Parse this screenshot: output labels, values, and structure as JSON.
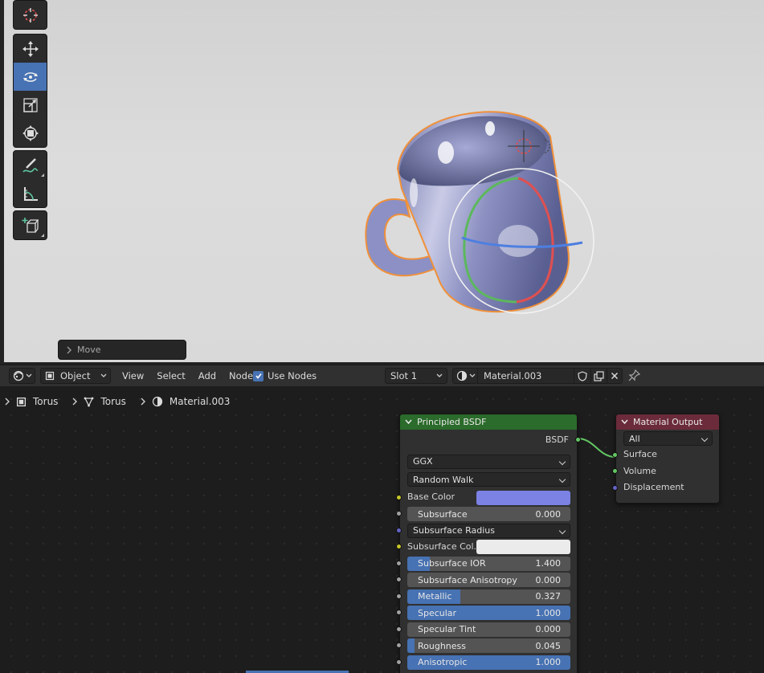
{
  "viewport": {
    "last_operator": "Move"
  },
  "node_editor": {
    "header": {
      "object_mode": "Object",
      "menus": [
        "View",
        "Select",
        "Add",
        "Node"
      ],
      "use_nodes_label": "Use Nodes",
      "use_nodes_checked": true,
      "slot": "Slot 1",
      "material_name": "Material.003"
    },
    "breadcrumb": [
      "Torus",
      "Torus",
      "Material.003"
    ],
    "principled_node": {
      "title": "Principled BSDF",
      "header_color": "#2b6b2b",
      "output_label": "BSDF",
      "distribution": "GGX",
      "subsurface_method": "Random Walk",
      "base_color_label": "Base Color",
      "base_color": "#7b82e4",
      "subsurface_color_label": "Subsurface Col..",
      "subsurface_color": "#ebebeb",
      "subsurface_radius_label": "Subsurface Radius",
      "sliders": [
        {
          "label": "Subsurface",
          "value": "0.000",
          "fill": 0.0
        },
        {
          "label": "Subsurface IOR",
          "value": "1.400",
          "fill": 0.14
        },
        {
          "label": "Subsurface Anisotropy",
          "value": "0.000",
          "fill": 0.0
        },
        {
          "label": "Metallic",
          "value": "0.327",
          "fill": 0.327
        },
        {
          "label": "Specular",
          "value": "1.000",
          "fill": 1.0
        },
        {
          "label": "Specular Tint",
          "value": "0.000",
          "fill": 0.0
        },
        {
          "label": "Roughness",
          "value": "0.045",
          "fill": 0.045
        },
        {
          "label": "Anisotropic",
          "value": "1.000",
          "fill": 1.0
        }
      ]
    },
    "output_node": {
      "title": "Material Output",
      "header_color": "#6b2b3a",
      "target": "All",
      "inputs": [
        "Surface",
        "Volume",
        "Displacement"
      ]
    }
  },
  "colors": {
    "accent": "#4772b3",
    "selection_outline": "#f0903a"
  }
}
